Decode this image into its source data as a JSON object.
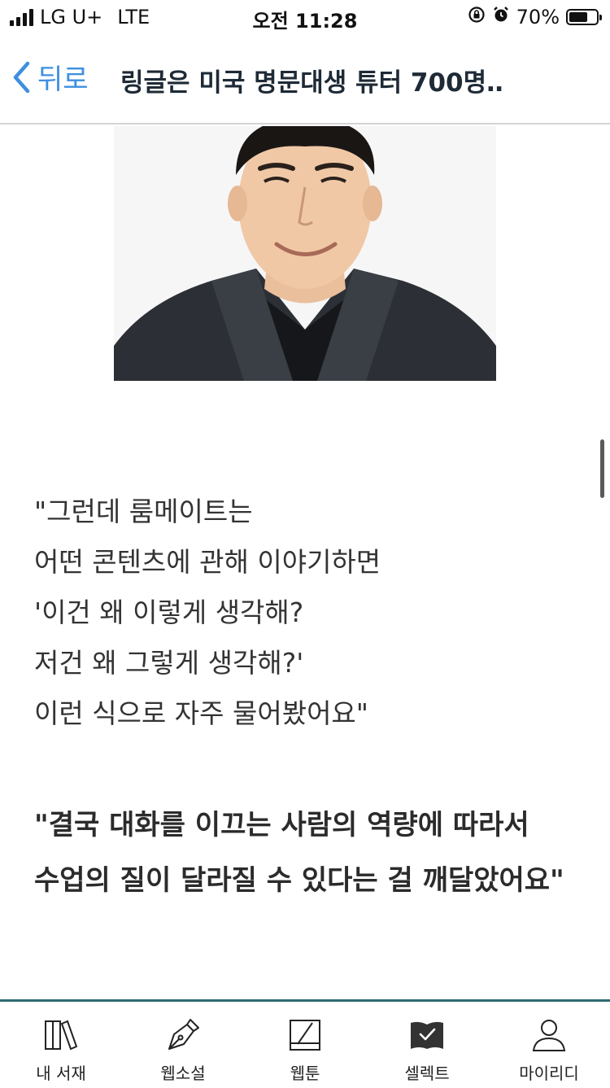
{
  "status_bar": {
    "carrier": "LG U+",
    "network": "LTE",
    "time": "오전 11:28",
    "battery_text": "70%",
    "battery_level": 0.7
  },
  "nav": {
    "back_label": "뒤로",
    "title": "링글은 미국 명문대생 튜터 700명…"
  },
  "article": {
    "quote_lines": [
      "\"그런데 룸메이트는",
      "어떤 콘텐츠에 관해 이야기하면",
      "'이건 왜 이렇게 생각해?",
      "저건 왜 그렇게 생각해?'",
      "이런 식으로 자주 물어봤어요\""
    ],
    "emphasis_lines": [
      "\"결국 대화를 이끄는 사람의 역량에 따라서",
      "수업의 질이 달라질 수 있다는 걸 깨달았어요\""
    ]
  },
  "tabbar": {
    "accent_color": "#2e6b74",
    "items": [
      {
        "label": "내 서재",
        "icon": "library-icon"
      },
      {
        "label": "웹소설",
        "icon": "pen-nib-icon"
      },
      {
        "label": "웹툰",
        "icon": "webtoon-icon"
      },
      {
        "label": "셀렉트",
        "icon": "select-book-icon"
      },
      {
        "label": "마이리디",
        "icon": "person-icon"
      }
    ]
  }
}
